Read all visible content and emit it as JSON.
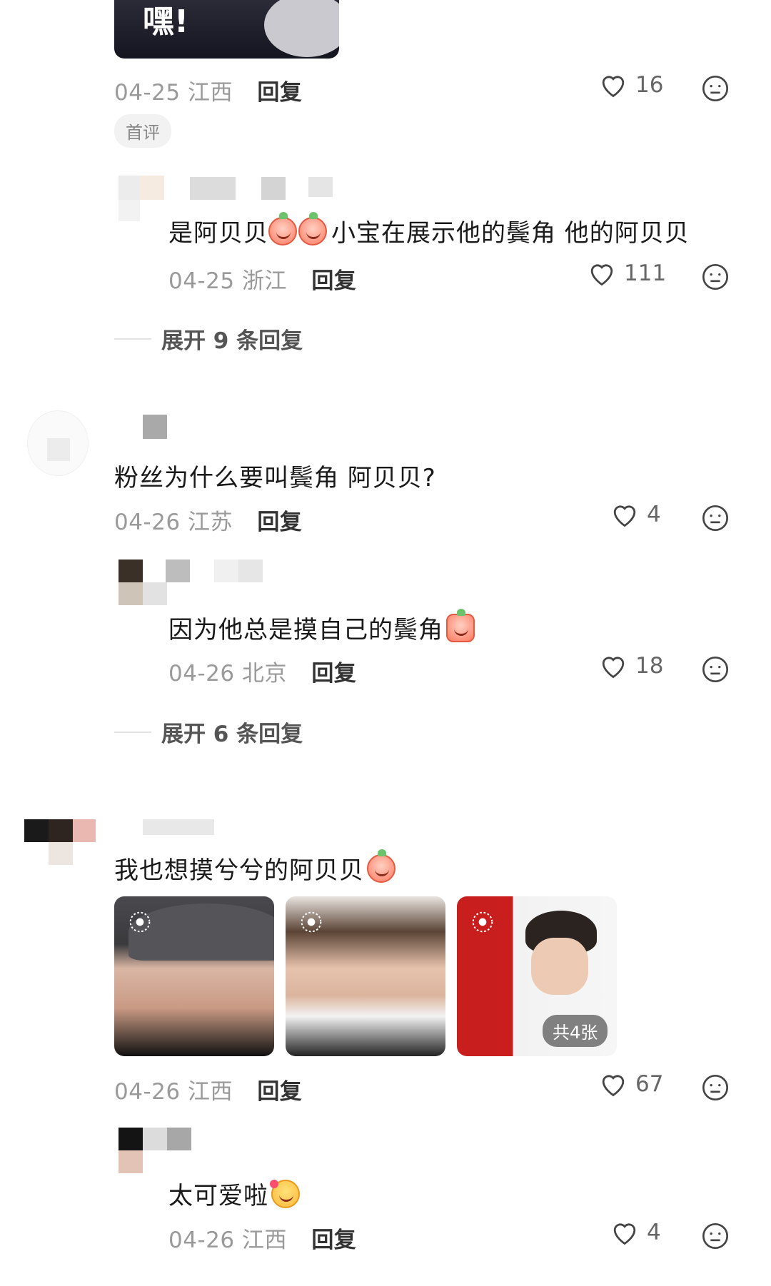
{
  "top_sticker": {
    "caption": "嘿!"
  },
  "comments": [
    {
      "date": "04-25",
      "loc": "江西",
      "reply": "回复",
      "likes": "16",
      "tag": "首评"
    },
    {
      "text": "是阿贝贝",
      "text2": "小宝在展示他的鬓角 他的阿贝贝",
      "date": "04-25",
      "loc": "浙江",
      "reply": "回复",
      "likes": "111"
    },
    {
      "text": "粉丝为什么要叫鬓角 阿贝贝?",
      "date": "04-26",
      "loc": "江苏",
      "reply": "回复",
      "likes": "4"
    },
    {
      "text": "因为他总是摸自己的鬓角",
      "date": "04-26",
      "loc": "北京",
      "reply": "回复",
      "likes": "18"
    },
    {
      "text": "我也想摸兮兮的阿贝贝",
      "date": "04-26",
      "loc": "江西",
      "reply": "回复",
      "likes": "67",
      "photo_count": "共4张"
    },
    {
      "text": "太可爱啦",
      "date": "04-26",
      "loc": "江西",
      "reply": "回复",
      "likes": "4"
    }
  ],
  "expand": [
    {
      "label": "展开 9 条回复"
    },
    {
      "label": "展开 6 条回复"
    }
  ],
  "icons": {
    "like": "heart-outline-icon",
    "dislike": "neutral-face-icon"
  }
}
